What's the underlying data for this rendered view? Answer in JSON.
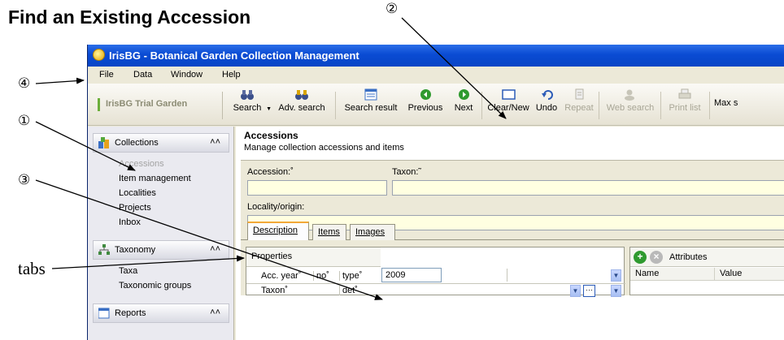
{
  "doc_title": "Find an Existing Accession",
  "callouts": {
    "c1": "①",
    "c2": "②",
    "c3": "③",
    "c4": "④",
    "tabs": "tabs"
  },
  "window": {
    "title": "IrisBG - Botanical Garden Collection Management",
    "menu": [
      "File",
      "Data",
      "Window",
      "Help"
    ],
    "garden": "IrisBG Trial Garden",
    "toolbar": {
      "search": "Search",
      "adv_search": "Adv. search",
      "search_result": "Search result",
      "previous": "Previous",
      "next": "Next",
      "clear_new": "Clear/New",
      "undo": "Undo",
      "repeat": "Repeat",
      "web_search": "Web search",
      "print_list": "Print list",
      "max": "Max s"
    }
  },
  "sidebar": {
    "collections": {
      "label": "Collections",
      "items": [
        "Accessions",
        "Item management",
        "Localities",
        "Projects",
        "Inbox"
      ]
    },
    "taxonomy": {
      "label": "Taxonomy",
      "items": [
        "Taxa",
        "Taxonomic groups"
      ]
    },
    "reports": {
      "label": "Reports"
    }
  },
  "main": {
    "title": "Accessions",
    "description": "Manage collection accessions and items",
    "form": {
      "accession_label": "Accession:˚",
      "taxon_label": "Taxon:˜",
      "locality_label": "Locality/origin:"
    },
    "tabs": [
      "Description",
      "Items",
      "Images"
    ],
    "properties": {
      "header": "Properties",
      "acc_year": "Acc. year˚",
      "no": "no˚",
      "type": "type˚",
      "year_value": "2009",
      "taxon": "Taxon˚",
      "det": "det˚"
    },
    "attributes": {
      "header": "Attributes",
      "col_name": "Name",
      "col_value": "Value"
    }
  },
  "colors": {
    "titlebar": "#0a4bd3",
    "input_bg": "#ffffe1",
    "tab_accent": "#f2a838",
    "sidebar_bg": "#eaeaf0"
  }
}
